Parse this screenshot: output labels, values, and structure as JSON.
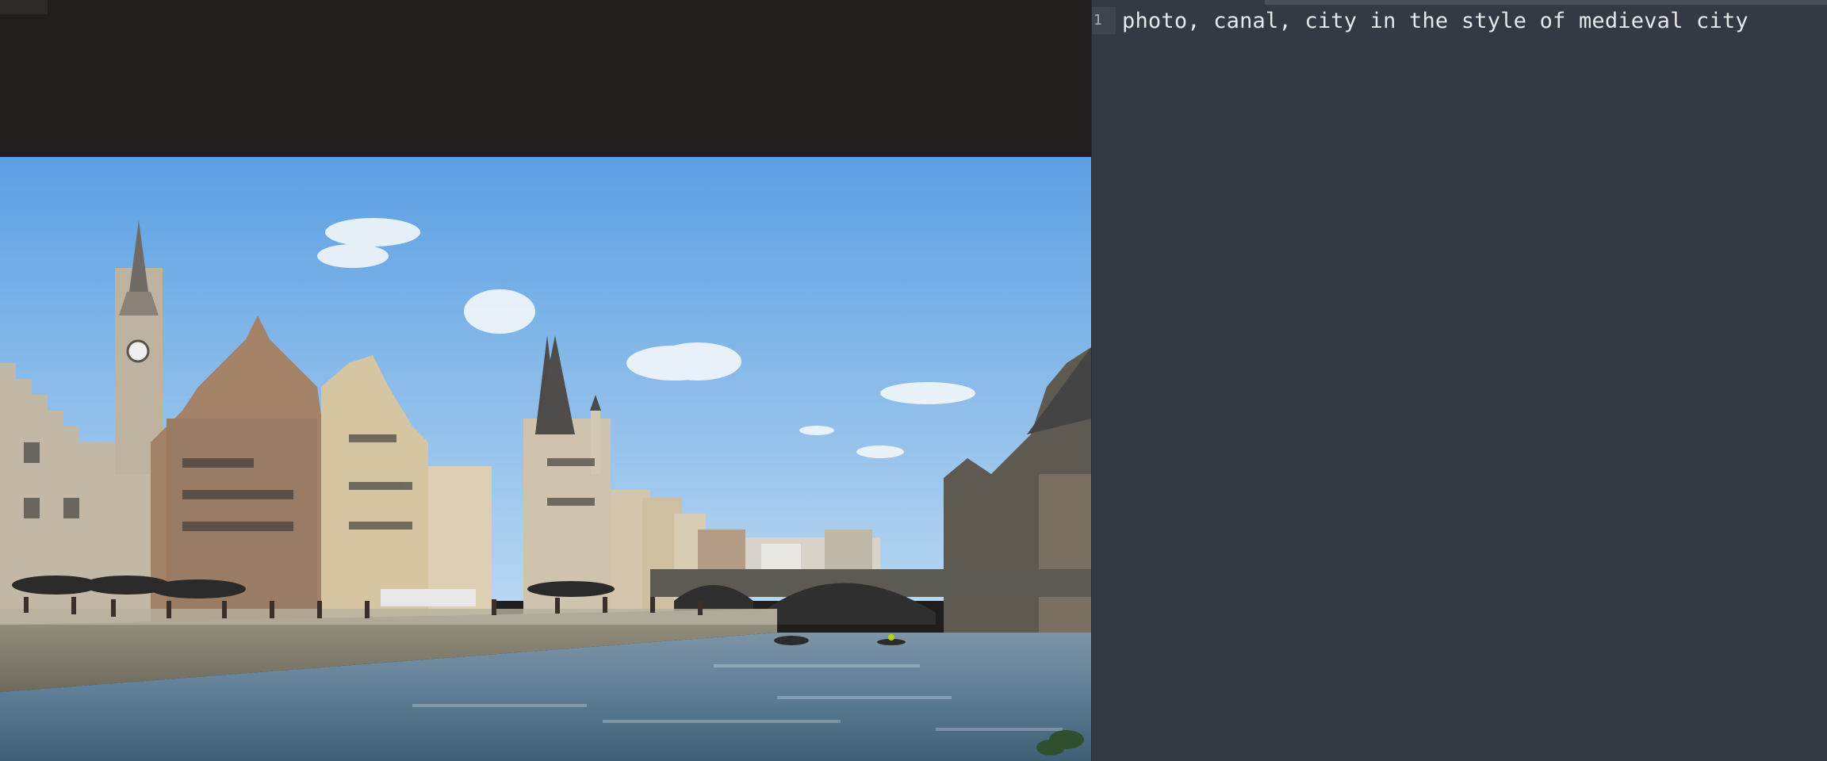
{
  "editor": {
    "line_number": "1",
    "prompt": "photo, canal, city in the style of medieval city"
  },
  "image": {
    "description_icon": "photo-of-canal-city"
  },
  "colors": {
    "left_background": "#1f1e1d",
    "right_background": "#343a43",
    "sky_top": "#5b9fe3",
    "sky_bottom": "#a9cdef",
    "water": "#5d7d9a"
  }
}
